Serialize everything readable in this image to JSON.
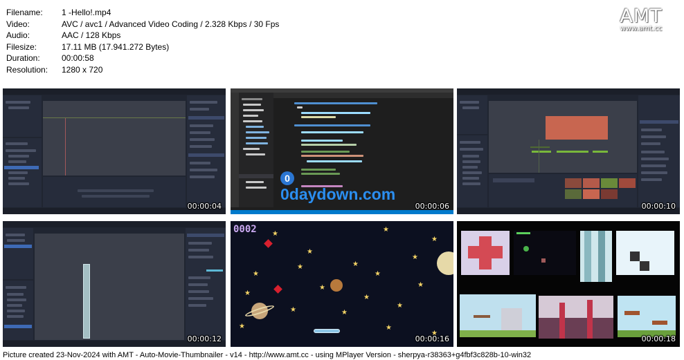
{
  "info": [
    {
      "key": "Filename:",
      "value": "1 -Hello!.mp4"
    },
    {
      "key": "Video:",
      "value": "AVC / avc1 / Advanced Video Coding / 2.328 Kbps / 30 Fps"
    },
    {
      "key": "Audio:",
      "value": "AAC / 128 Kbps"
    },
    {
      "key": "Filesize:",
      "value": "17.11 MB (17.941.272 Bytes)"
    },
    {
      "key": "Duration:",
      "value": "00:00:58"
    },
    {
      "key": "Resolution:",
      "value": "1280 x 720"
    }
  ],
  "logo": {
    "main": "AMT",
    "sub": "www.amt.cc"
  },
  "thumbnails": [
    {
      "timestamp": "00:00:04"
    },
    {
      "timestamp": "00:00:06",
      "watermark": "0daydown.com"
    },
    {
      "timestamp": "00:00:10"
    },
    {
      "timestamp": "00:00:12"
    },
    {
      "timestamp": "00:00:16",
      "score": "0002"
    },
    {
      "timestamp": "00:00:18"
    }
  ],
  "footer": "Picture created 23-Nov-2024 with AMT - Auto-Movie-Thumbnailer - v14 - http://www.amt.cc - using MPlayer Version - sherpya-r38363+g4fbf3c828b-10-win32",
  "colors": {
    "godot_bg": "#202531",
    "vscode_bg": "#1e1e1e",
    "space_bg": "#0c1020",
    "star": "#f5d466"
  }
}
